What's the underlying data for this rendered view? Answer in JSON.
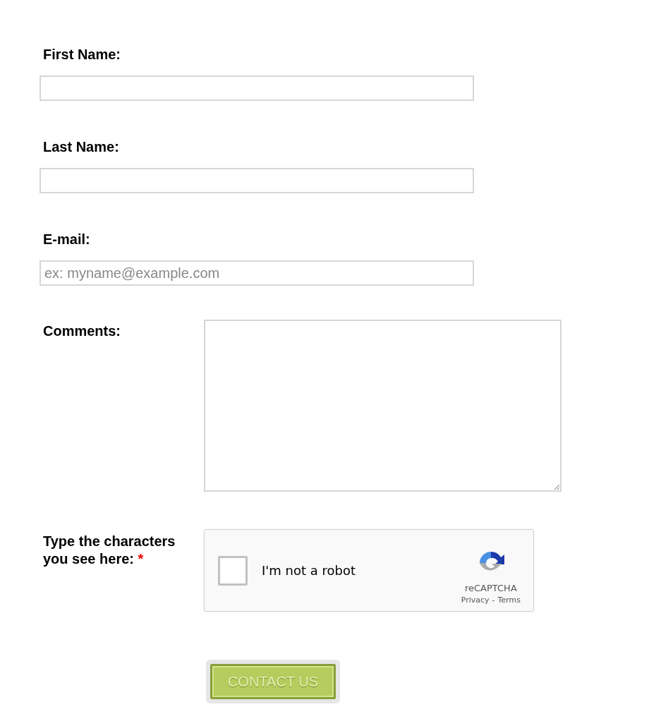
{
  "fields": [
    {
      "kind": "input",
      "label": "First Name:"
    },
    {
      "kind": "input",
      "label": "Last Name:"
    },
    {
      "kind": "input",
      "label": "E-mail:",
      "placeholder": "ex: myname@example.com"
    },
    {
      "kind": "textarea",
      "label": "Comments:"
    }
  ],
  "captcha": {
    "label": "Type the characters you see here:",
    "required_mark": "*",
    "checked": false,
    "text": "I'm not a robot",
    "brand": "reCAPTCHA",
    "privacy": "Privacy",
    "separator": "-",
    "terms": "Terms"
  },
  "submit": "CONTACT US"
}
